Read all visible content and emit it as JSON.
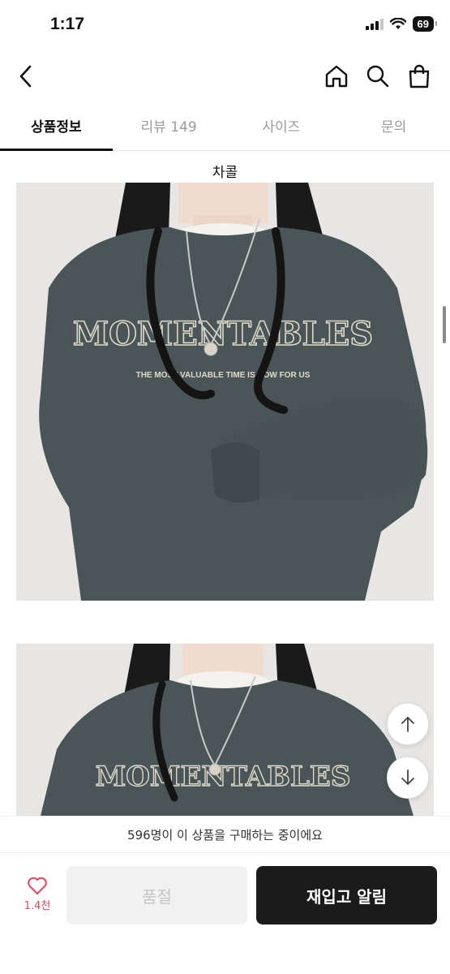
{
  "status_bar": {
    "time": "1:17",
    "battery": "69"
  },
  "icons": {
    "back": "chevron-left-icon",
    "home": "home-icon",
    "search": "search-icon",
    "bag": "shopping-bag-icon",
    "like": "heart-icon",
    "scroll_up": "arrow-up-icon",
    "scroll_down": "arrow-down-icon"
  },
  "tabs": [
    {
      "label": "상품정보",
      "active": true
    },
    {
      "label": "리뷰 149",
      "active": false
    },
    {
      "label": "사이즈",
      "active": false
    },
    {
      "label": "문의",
      "active": false
    }
  ],
  "product": {
    "color_label": "차콜",
    "print_title": "MOMENTABLES",
    "print_subtitle": "THE MOST VALUABLE TIME IS NOW FOR US",
    "sweatshirt_color": "#4a5558"
  },
  "notice": "596명이 이 상품을 구매하는 중이에요",
  "bottom": {
    "like_count": "1.4천",
    "soldout_label": "품절",
    "restock_label": "재입고 알림"
  },
  "colors": {
    "accent": "#e0475f",
    "primary_button": "#1b1b1b",
    "disabled_button": "#f1f1f1"
  }
}
